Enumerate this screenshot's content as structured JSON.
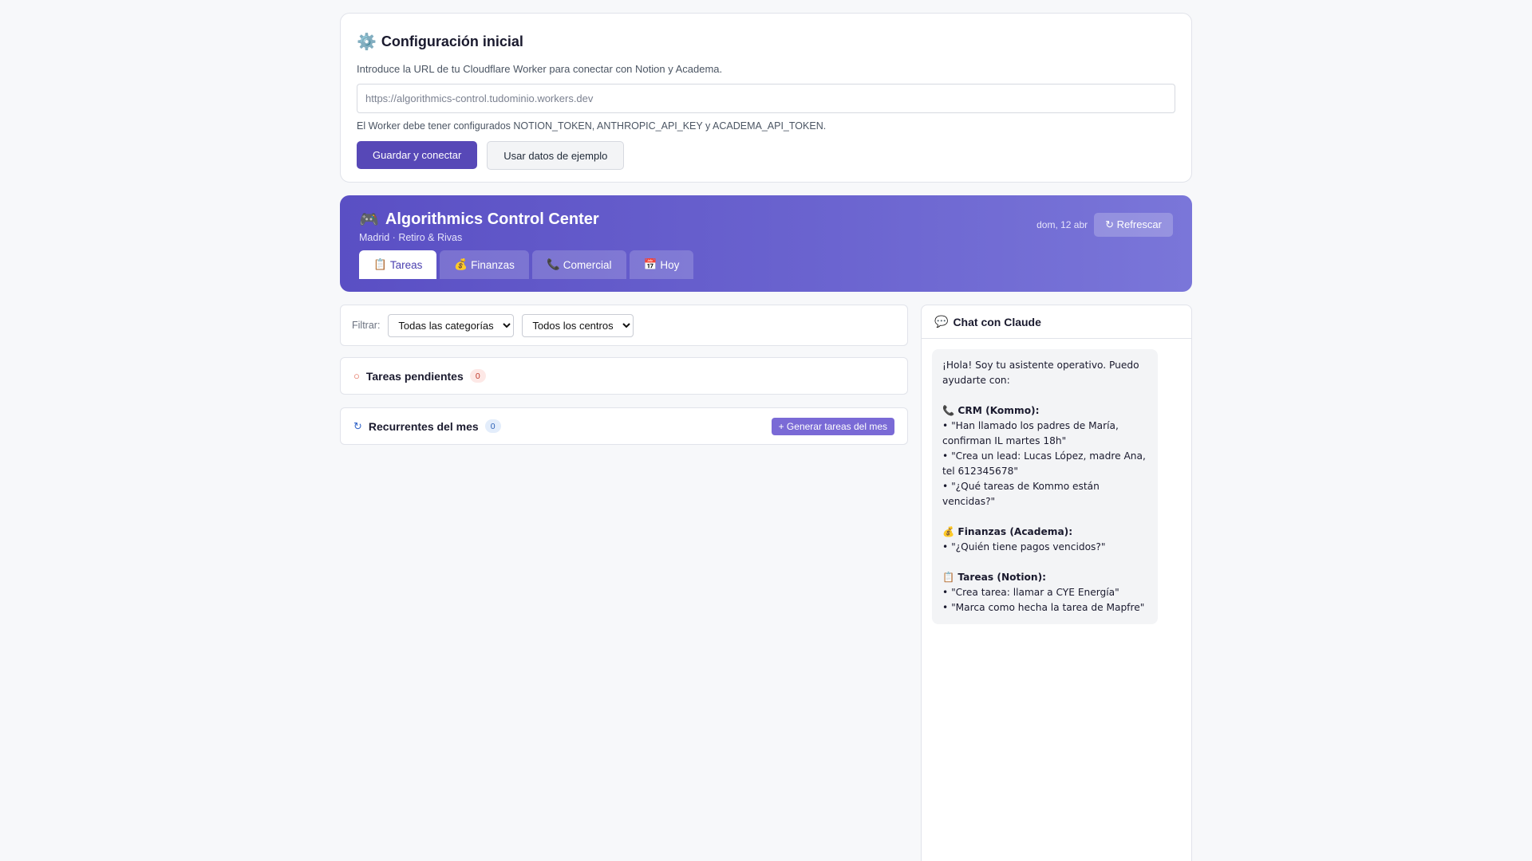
{
  "config": {
    "icon": "gear-icon",
    "icon_glyph": "⚙️",
    "title": "Configuración inicial",
    "description": "Introduce la URL de tu Cloudflare Worker para conectar con Notion y Academa.",
    "url_placeholder": "https://algorithmics-control.tudominio.workers.dev",
    "url_value": "",
    "note": "El Worker debe tener configurados NOTION_TOKEN, ANTHROPIC_API_KEY y ACADEMA_API_TOKEN.",
    "save_button": "Guardar y conectar",
    "sample_button": "Usar datos de ejemplo"
  },
  "header": {
    "icon": "gamepad-icon",
    "icon_glyph": "🎮",
    "title": "Algorithmics Control Center",
    "subtitle": "Madrid · Retiro & Rivas",
    "date": "dom, 12 abr",
    "refresh_button": "↻ Refrescar",
    "tabs": [
      {
        "icon": "clipboard-icon",
        "glyph": "📋",
        "label": "Tareas",
        "active": true
      },
      {
        "icon": "money-bag-icon",
        "glyph": "💰",
        "label": "Finanzas",
        "active": false
      },
      {
        "icon": "phone-icon",
        "glyph": "📞",
        "label": "Comercial",
        "active": false
      },
      {
        "icon": "calendar-icon",
        "glyph": "📅",
        "label": "Hoy",
        "active": false
      }
    ]
  },
  "filters": {
    "label": "Filtrar:",
    "category_selected": "Todas las categorías",
    "center_selected": "Todos los centros"
  },
  "sections": {
    "pending": {
      "icon_glyph": "○",
      "title": "Tareas pendientes",
      "count": "0"
    },
    "recurring": {
      "icon_glyph": "↻",
      "title": "Recurrentes del mes",
      "count": "0",
      "generate_button": "+ Generar tareas del mes"
    }
  },
  "chat": {
    "icon": "speech-bubble-icon",
    "icon_glyph": "💬",
    "title": "Chat con Claude",
    "message": {
      "intro": "¡Hola! Soy tu asistente operativo. Puedo ayudarte con:",
      "crm_heading": "📞 CRM (Kommo):",
      "crm_items": [
        "• \"Han llamado los padres de María, confirman IL martes 18h\"",
        "• \"Crea un lead: Lucas López, madre Ana, tel 612345678\"",
        "• \"¿Qué tareas de Kommo están vencidas?\""
      ],
      "finance_heading": "💰 Finanzas (Academa):",
      "finance_items": [
        "• \"¿Quién tiene pagos vencidos?\""
      ],
      "tasks_heading": "📋 Tareas (Notion):",
      "tasks_items": [
        "• \"Crea tarea: llamar a CYE Energía\"",
        "• \"Marca como hecha la tarea de Mapfre\""
      ]
    }
  },
  "colors": {
    "accent": "#5748b7",
    "header_gradient_start": "#5a4fc4",
    "header_gradient_end": "#7a76d9",
    "page_background": "#f7f8fa"
  }
}
